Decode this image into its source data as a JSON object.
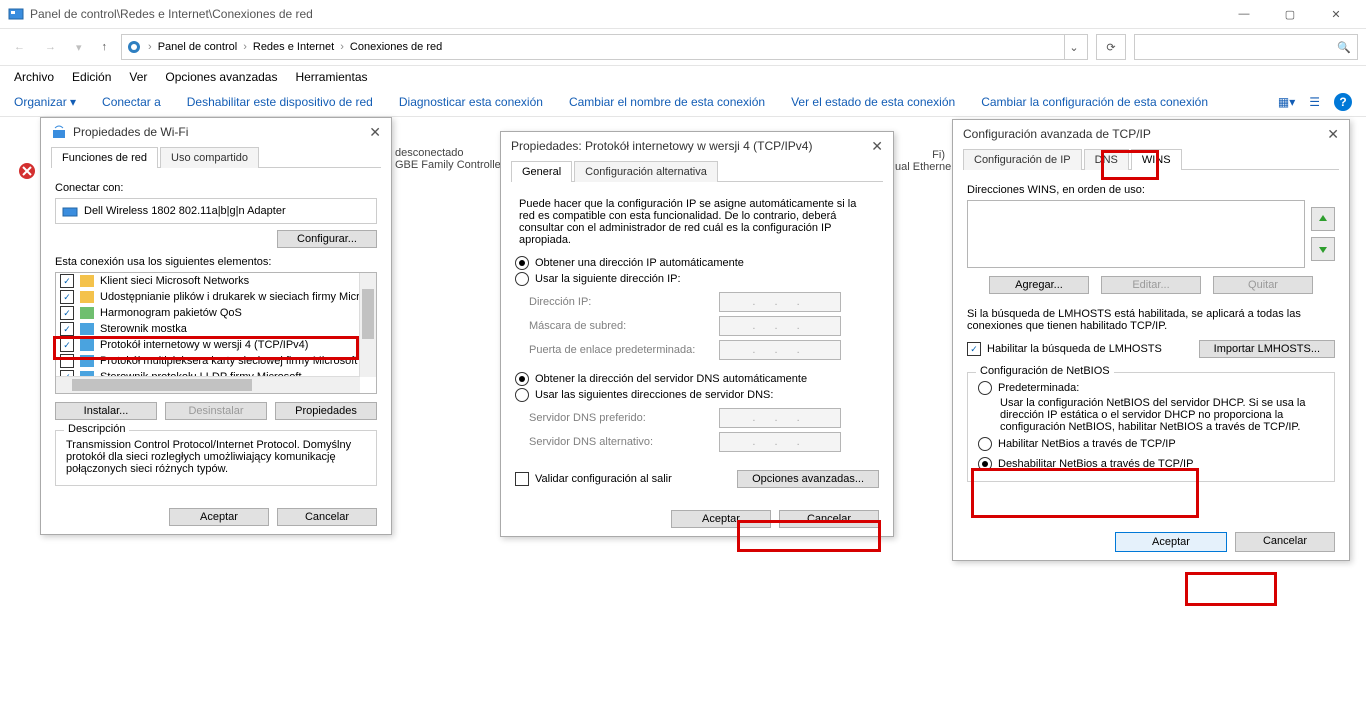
{
  "window": {
    "title": "Panel de control\\Redes e Internet\\Conexiones de red"
  },
  "breadcrumb": {
    "items": [
      "Panel de control",
      "Redes e Internet",
      "Conexiones de red"
    ]
  },
  "menu": [
    "Archivo",
    "Edición",
    "Ver",
    "Opciones avanzadas",
    "Herramientas"
  ],
  "toolbar": {
    "organize": "Organizar",
    "connect": "Conectar a",
    "disable": "Deshabilitar este dispositivo de red",
    "diagnose": "Diagnosticar esta conexión",
    "rename": "Cambiar el nombre de esta conexión",
    "status": "Ver el estado de esta conexión",
    "change": "Cambiar la configuración de esta conexión"
  },
  "bg": {
    "a1_line1": "desconectado",
    "a1_line2": "GBE Family Controlle",
    "a2_line1": "Fi)",
    "a2_line2": "ual Etherne"
  },
  "wifi_dialog": {
    "title": "Propiedades de Wi-Fi",
    "tab1": "Funciones de red",
    "tab2": "Uso compartido",
    "connect_with": "Conectar con:",
    "adapter": "Dell Wireless 1802 802.11a|b|g|n Adapter",
    "configure": "Configurar...",
    "uses": "Esta conexión usa los siguientes elementos:",
    "items": [
      "Klient sieci Microsoft Networks",
      "Udostępnianie plików i drukarek w sieciach firmy Micros",
      "Harmonogram pakietów QoS",
      "Sterownik mostka",
      "Protokół internetowy w wersji 4 (TCP/IPv4)",
      "Protokół multipleksera karty sieciowej firmy Microsoft",
      "Sterownik protokołu LLDP firmy Microsoft"
    ],
    "install": "Instalar...",
    "uninstall": "Desinstalar",
    "properties": "Propiedades",
    "desc_label": "Descripción",
    "desc_text": "Transmission Control Protocol/Internet Protocol. Domyślny protokół dla sieci rozległych umożliwiający komunikację połączonych sieci różnych typów.",
    "ok": "Aceptar",
    "cancel": "Cancelar"
  },
  "ipv4_dialog": {
    "title": "Propiedades: Protokół internetowy w wersji 4 (TCP/IPv4)",
    "tab1": "General",
    "tab2": "Configuración alternativa",
    "intro": "Puede hacer que la configuración IP se asigne automáticamente si la red es compatible con esta funcionalidad. De lo contrario, deberá consultar con el administrador de red cuál es la configuración IP apropiada.",
    "auto_ip": "Obtener una dirección IP automáticamente",
    "manual_ip": "Usar la siguiente dirección IP:",
    "ip": "Dirección IP:",
    "mask": "Máscara de subred:",
    "gw": "Puerta de enlace predeterminada:",
    "auto_dns": "Obtener la dirección del servidor DNS automáticamente",
    "manual_dns": "Usar las siguientes direcciones de servidor DNS:",
    "dns1": "Servidor DNS preferido:",
    "dns2": "Servidor DNS alternativo:",
    "validate": "Validar configuración al salir",
    "advanced": "Opciones avanzadas...",
    "ok": "Aceptar",
    "cancel": "Cancelar"
  },
  "adv_dialog": {
    "title": "Configuración avanzada de TCP/IP",
    "tab1": "Configuración de IP",
    "tab2": "DNS",
    "tab3": "WINS",
    "wins_label": "Direcciones WINS, en orden de uso:",
    "add": "Agregar...",
    "edit": "Editar...",
    "remove": "Quitar",
    "lmhosts_text": "Si la búsqueda de LMHOSTS está habilitada, se aplicará a todas las conexiones que tienen habilitado TCP/IP.",
    "enable_lmhosts": "Habilitar la búsqueda de LMHOSTS",
    "import_lmhosts": "Importar LMHOSTS...",
    "netbios_legend": "Configuración de NetBIOS",
    "nb_default": "Predeterminada:",
    "nb_default_desc": "Usar la configuración NetBIOS del servidor DHCP. Si se usa la dirección IP estática o el servidor DHCP no proporciona la configuración NetBIOS, habilitar NetBIOS a través de TCP/IP.",
    "nb_enable": "Habilitar NetBios a través de TCP/IP",
    "nb_disable": "Deshabilitar NetBios a través de TCP/IP",
    "ok": "Aceptar",
    "cancel": "Cancelar"
  }
}
